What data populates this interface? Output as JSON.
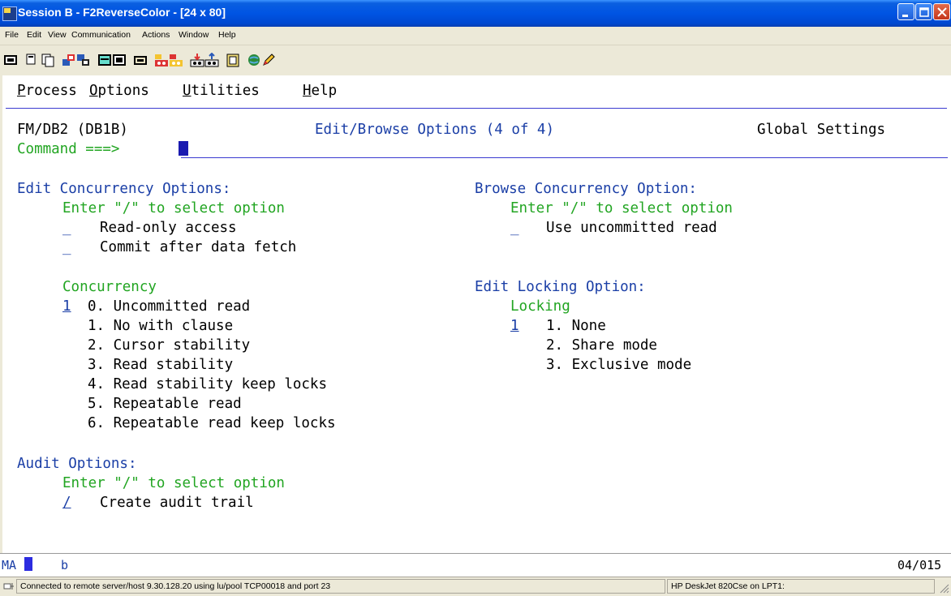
{
  "window": {
    "title": "Session B - F2ReverseColor - [24 x 80]"
  },
  "menu": {
    "items": [
      "File",
      "Edit",
      "View",
      "Communication",
      "Actions",
      "Window",
      "Help"
    ]
  },
  "toolbar": {
    "icons": [
      "display-icon",
      "copy-icon",
      "paste-icon",
      "send-icon",
      "receive-icon",
      "keypad-icon",
      "macro-icon",
      "record-icon",
      "play-macro-icon",
      "stop-macro-icon",
      "transfer-send-icon",
      "transfer-receive-icon",
      "clipboard-icon",
      "web-icon",
      "edit-icon"
    ]
  },
  "terminal": {
    "action_bar": [
      "Process",
      "Options",
      "Utilities",
      "Help"
    ],
    "product": "FM/DB2 (DB1B)",
    "panel_title": "Edit/Browse Options (4 of 4)",
    "scope": "Global Settings",
    "command_label": "Command ===>",
    "command_value": "",
    "edit_concurrency": {
      "heading": "Edit Concurrency Options:",
      "instruction": "Enter \"/\" to select option",
      "options": [
        {
          "field": "_",
          "label": "Read-only access"
        },
        {
          "field": "_",
          "label": "Commit after data fetch"
        }
      ]
    },
    "browse_concurrency": {
      "heading": "Browse Concurrency Option:",
      "instruction": "Enter \"/\" to select option",
      "options": [
        {
          "field": "_",
          "label": "Use uncommitted read"
        }
      ]
    },
    "concurrency": {
      "heading": "Concurrency",
      "value": "1",
      "choices": [
        "0. Uncommitted read",
        "1. No with clause",
        "2. Cursor stability",
        "3. Read stability",
        "4. Read stability keep locks",
        "5. Repeatable read",
        "6. Repeatable read keep locks"
      ]
    },
    "edit_locking": {
      "heading": "Edit Locking Option:",
      "subheading": "Locking",
      "value": "1",
      "choices": [
        "1. None",
        "2. Share mode",
        "3. Exclusive mode"
      ]
    },
    "audit": {
      "heading": "Audit Options:",
      "instruction": "Enter \"/\" to select option",
      "field": "/",
      "label": "Create audit trail"
    }
  },
  "oia": {
    "mode": "MA",
    "indicator": "b",
    "cursor_position": "04/015"
  },
  "statusbar": {
    "connection": "Connected to remote server/host 9.30.128.20 using lu/pool TCP00018 and port 23",
    "printer": "HP DeskJet 820Cse on LPT1:"
  }
}
